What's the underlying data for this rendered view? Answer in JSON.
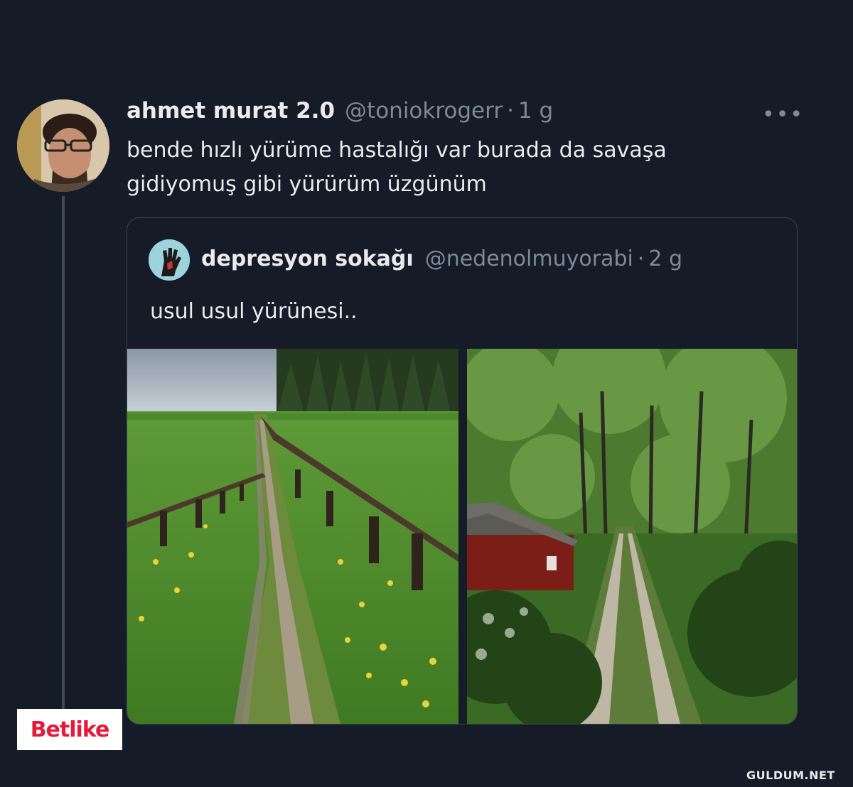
{
  "tweet": {
    "name": "ahmet murat 2.0",
    "handle": "@toniokrogerr",
    "separator": "·",
    "time": "1 g",
    "more_label": "•••",
    "text": "bende hızlı yürüme hastalığı var burada da savaşa gidiyomuş gibi yürürüm üzgünüm"
  },
  "quote": {
    "name": "depresyon sokağı",
    "handle": "@nedenolmuyorabi",
    "separator": "·",
    "time": "2 g",
    "text": "usul usul yürünesi.."
  },
  "watermarks": {
    "brand": "Betlike",
    "site": "GULDUM.NET"
  },
  "colors": {
    "background": "#151b27",
    "primary_text": "#e9ebee",
    "secondary_text": "#7e8a97",
    "border": "#3b4654"
  }
}
